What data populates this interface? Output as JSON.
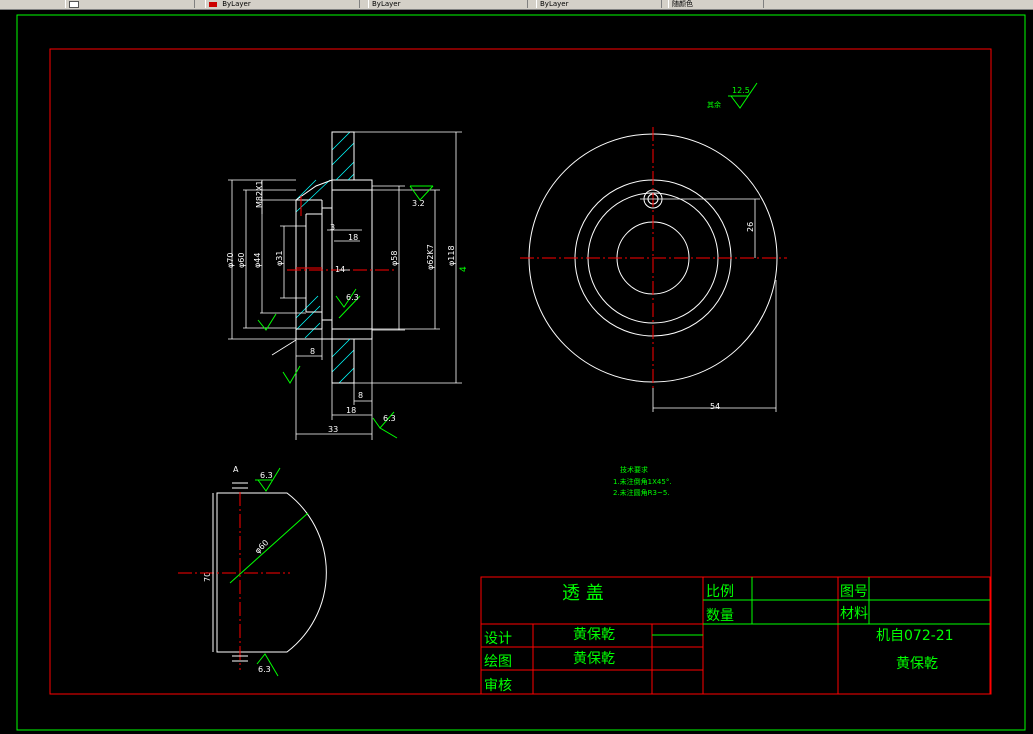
{
  "toolbar": {
    "layer_value": "",
    "color_value": "ByLayer",
    "linetype_value": "ByLayer",
    "lineweight_value": "ByLayer",
    "plotstyle_value": "随颜色"
  },
  "drawing": {
    "title_block": {
      "part_name": "透  盖",
      "scale_label": "比例",
      "quantity_label": "数量",
      "drawing_no_label": "图号",
      "material_label": "材料",
      "design_label": "设计",
      "drafting_label": "绘图",
      "review_label": "审核",
      "designer": "黄保乾",
      "drafter": "黄保乾",
      "class_code": "机自072-21",
      "student": "黄保乾"
    },
    "tech_req": {
      "heading": "技术要求",
      "line1": "1.未注倒角1X45°.",
      "line2": "2.未注圆角R3~5."
    },
    "surface_note": {
      "label": "其余",
      "value": "12.5"
    },
    "dims": {
      "m82": "M82X1",
      "d70": "φ70",
      "d60": "φ60",
      "d44": "φ44",
      "d31": "φ31",
      "d58": "φ58",
      "d62": "φ62K7",
      "d118": "φ118",
      "n3": "3",
      "n18a": "18",
      "n14": "14",
      "n8a": "8",
      "n8b": "8",
      "n18b": "18",
      "n33": "33",
      "r32": "3.2",
      "r63a": "6.3",
      "r63b": "6.3",
      "r63c": "6.3",
      "r63d": "6.3",
      "n26": "26",
      "n54": "54",
      "d60b": "φ60",
      "n70": "70",
      "letter_a": "A"
    }
  }
}
